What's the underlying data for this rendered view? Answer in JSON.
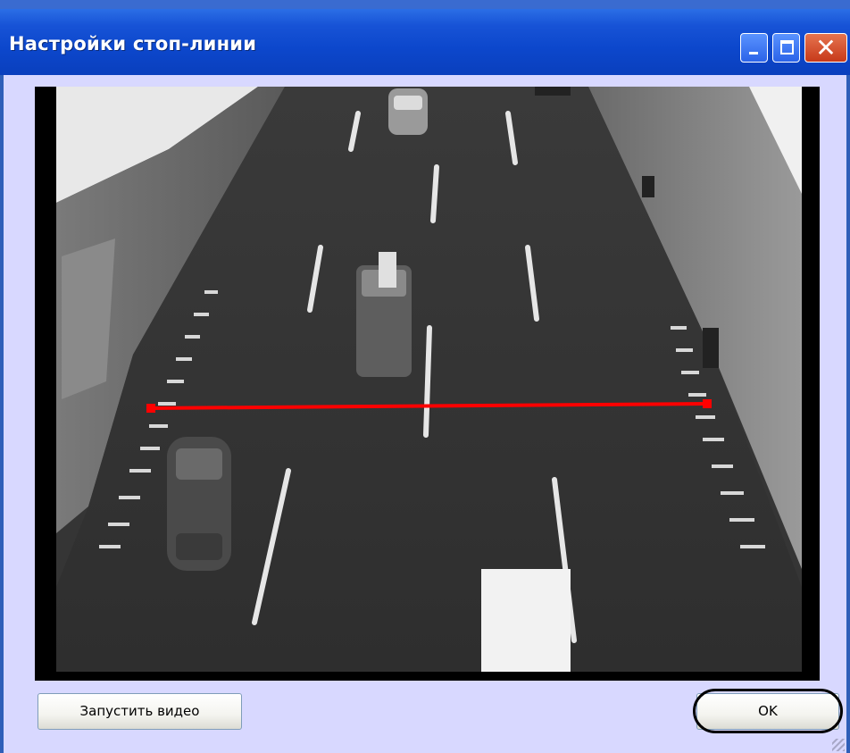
{
  "window": {
    "title": "Настройки стоп-линии",
    "controls": {
      "minimize": "minimize-icon",
      "maximize": "maximize-icon",
      "close": "close-icon"
    }
  },
  "video": {
    "stop_line_color": "#ff0000",
    "stop_line_handles": 2
  },
  "buttons": {
    "start_video": "Запустить видео",
    "ok": "OK"
  },
  "colors": {
    "titlebar": "#0c47cc",
    "client": "#d8d8ff",
    "close_button": "#c7391a"
  }
}
